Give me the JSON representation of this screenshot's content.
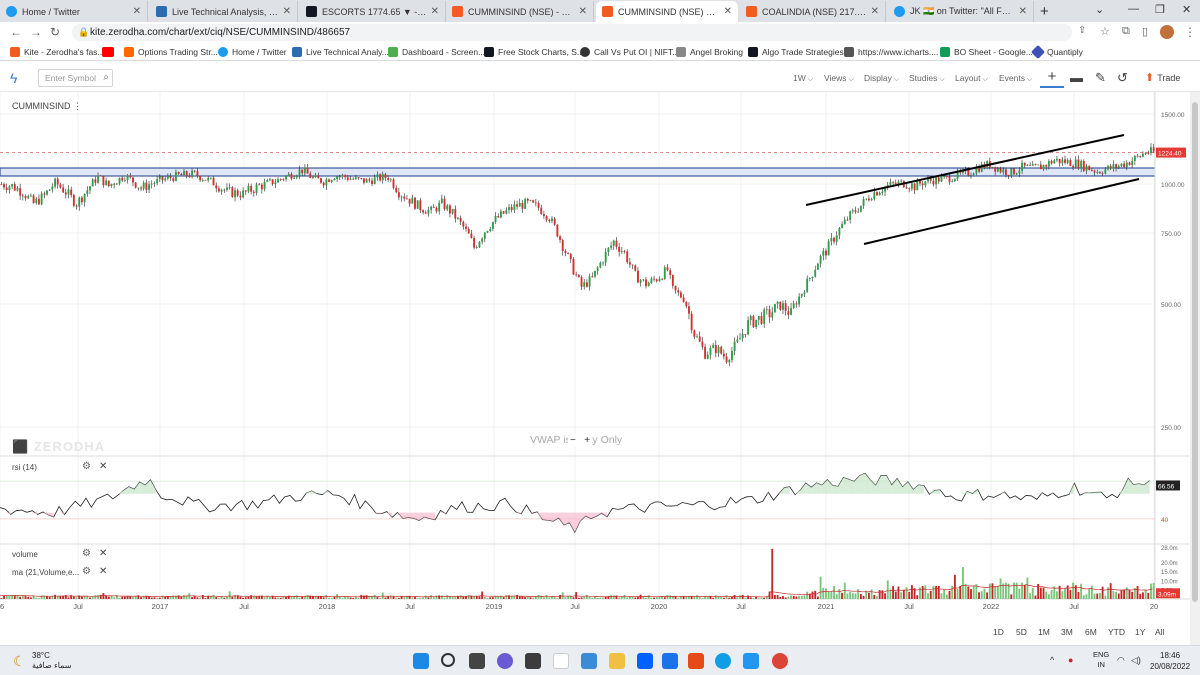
{
  "browser": {
    "tabs": [
      {
        "label": "Home / Twitter",
        "color": "#1d9bf0"
      },
      {
        "label": "Live Technical Analysis, Charts, S",
        "color": "#2b6cb0"
      },
      {
        "label": "ESCORTS 1774.65 ▼ -1.61% NIF",
        "color": "#131722"
      },
      {
        "label": "CUMMINSIND (NSE) - Kite Chart",
        "color": "#f25b21"
      },
      {
        "label": "CUMMINSIND (NSE) 1224.4 - Ki",
        "color": "#f25b21"
      },
      {
        "label": "COALINDIA (NSE) 217.15 - Kite",
        "color": "#f25b21"
      },
      {
        "label": "JK 🇮🇳 on Twitter: \"All FNO Stocks",
        "color": "#1d9bf0"
      }
    ],
    "active_tab": 4,
    "url": "kite.zerodha.com/chart/ext/ciq/NSE/CUMMINSIND/486657",
    "bookmarks": [
      {
        "label": "Kite - Zerodha's fas...",
        "color": "#f25b21"
      },
      {
        "label": "",
        "color": "#ff0000"
      },
      {
        "label": "Options Trading Str...",
        "color": "#ff6a00"
      },
      {
        "label": "Home / Twitter",
        "color": "#1d9bf0"
      },
      {
        "label": "Live Technical Analy...",
        "color": "#2b6cb0"
      },
      {
        "label": "Dashboard - Screen...",
        "color": "#4caf50"
      },
      {
        "label": "Free Stock Charts, S...",
        "color": "#131722"
      },
      {
        "label": "Call Vs Put OI | NIFT...",
        "color": "#333333"
      },
      {
        "label": "Angel Broking",
        "color": "#888888"
      },
      {
        "label": "Algo Trade Strategies",
        "color": "#131722"
      },
      {
        "label": "https://www.icharts....",
        "color": "#555555"
      },
      {
        "label": "BO Sheet - Google...",
        "color": "#0f9d58"
      },
      {
        "label": "Quantiply",
        "color": "#3f51b5"
      }
    ]
  },
  "kite": {
    "symbol_placeholder": "Enter Symbol",
    "menus": [
      "1W",
      "Views",
      "Display",
      "Studies",
      "Layout",
      "Events"
    ],
    "trade_label": "Trade",
    "symbol": "CUMMINSIND",
    "watermark": "ZERODHA",
    "vwap_note": "VWAP is  ·  ·  ay Only",
    "zoom_minus": "−",
    "zoom_plus": "+",
    "rsi_label": "rsi (14)",
    "volume_label": "volume",
    "ma_label": "ma (21,Volume,e...",
    "ranges": [
      "1D",
      "5D",
      "1M",
      "3M",
      "6M",
      "YTD",
      "1Y",
      "All"
    ]
  },
  "chart_data": {
    "type": "candlestick",
    "title": "CUMMINSIND",
    "interval": "1W",
    "last_price": "1224.40",
    "y_ticks": [
      "1500.00",
      "1000.00",
      "750.00",
      "500.00",
      "250.00"
    ],
    "x_ticks": [
      "6",
      "Jul",
      "2017",
      "Jul",
      "2018",
      "Jul",
      "2019",
      "Jul",
      "2020",
      "Jul",
      "2021",
      "Jul",
      "2022",
      "Jul",
      "20"
    ],
    "rsi": {
      "period": 14,
      "last": "66.56",
      "levels": [
        70,
        40
      ],
      "level_labels": [
        "",
        "40"
      ]
    },
    "volume": {
      "ticks": [
        "28.0m",
        "20.0m",
        "15.0m",
        "10.0m",
        "5.00m"
      ],
      "last": "3.09m"
    },
    "price_path": [
      [
        0,
        1000
      ],
      [
        4,
        990
      ],
      [
        8,
        960
      ],
      [
        12,
        900
      ],
      [
        16,
        940
      ],
      [
        20,
        1010
      ],
      [
        24,
        960
      ],
      [
        28,
        900
      ],
      [
        32,
        970
      ],
      [
        36,
        1050
      ],
      [
        40,
        990
      ],
      [
        46,
        1060
      ],
      [
        52,
        980
      ],
      [
        60,
        1030
      ],
      [
        66,
        1060
      ],
      [
        72,
        1070
      ],
      [
        78,
        1020
      ],
      [
        84,
        960
      ],
      [
        90,
        950
      ],
      [
        96,
        990
      ],
      [
        102,
        1020
      ],
      [
        108,
        1070
      ],
      [
        112,
        1100
      ],
      [
        116,
        1040
      ],
      [
        120,
        1020
      ],
      [
        124,
        1060
      ],
      [
        128,
        1050
      ],
      [
        132,
        1030
      ],
      [
        136,
        1020
      ],
      [
        140,
        1040
      ],
      [
        144,
        1050
      ],
      [
        148,
        960
      ],
      [
        152,
        920
      ],
      [
        156,
        880
      ],
      [
        160,
        860
      ],
      [
        164,
        900
      ],
      [
        168,
        850
      ],
      [
        172,
        780
      ],
      [
        176,
        700
      ],
      [
        180,
        760
      ],
      [
        184,
        820
      ],
      [
        188,
        860
      ],
      [
        192,
        890
      ],
      [
        196,
        900
      ],
      [
        200,
        880
      ],
      [
        204,
        830
      ],
      [
        208,
        730
      ],
      [
        212,
        640
      ],
      [
        216,
        560
      ],
      [
        220,
        590
      ],
      [
        224,
        660
      ],
      [
        228,
        720
      ],
      [
        232,
        680
      ],
      [
        236,
        600
      ],
      [
        240,
        570
      ],
      [
        244,
        590
      ],
      [
        248,
        620
      ],
      [
        250,
        550
      ],
      [
        254,
        520
      ],
      [
        258,
        440
      ],
      [
        262,
        400
      ],
      [
        266,
        410
      ],
      [
        270,
        390
      ],
      [
        274,
        420
      ],
      [
        278,
        460
      ],
      [
        282,
        470
      ],
      [
        286,
        480
      ],
      [
        290,
        500
      ],
      [
        294,
        480
      ],
      [
        298,
        540
      ],
      [
        302,
        610
      ],
      [
        304,
        650
      ],
      [
        308,
        700
      ],
      [
        312,
        770
      ],
      [
        316,
        840
      ],
      [
        320,
        890
      ],
      [
        324,
        950
      ],
      [
        328,
        980
      ],
      [
        332,
        1000
      ],
      [
        336,
        1010
      ],
      [
        340,
        990
      ],
      [
        344,
        1020
      ],
      [
        348,
        1030
      ],
      [
        352,
        1040
      ],
      [
        356,
        1060
      ],
      [
        360,
        1080
      ],
      [
        364,
        1120
      ],
      [
        368,
        1140
      ],
      [
        372,
        1100
      ],
      [
        376,
        1080
      ],
      [
        380,
        1120
      ],
      [
        384,
        1110
      ],
      [
        388,
        1130
      ],
      [
        392,
        1170
      ],
      [
        396,
        1160
      ],
      [
        400,
        1150
      ],
      [
        404,
        1120
      ],
      [
        408,
        1090
      ],
      [
        412,
        1110
      ],
      [
        416,
        1130
      ],
      [
        420,
        1160
      ],
      [
        424,
        1200
      ],
      [
        426,
        1230
      ],
      [
        428,
        1226
      ]
    ],
    "rsi_path": [
      [
        0,
        48
      ],
      [
        20,
        45
      ],
      [
        40,
        56
      ],
      [
        55,
        72
      ],
      [
        60,
        60
      ],
      [
        75,
        50
      ],
      [
        95,
        52
      ],
      [
        110,
        58
      ],
      [
        125,
        60
      ],
      [
        140,
        48
      ],
      [
        155,
        40
      ],
      [
        170,
        49
      ],
      [
        190,
        52
      ],
      [
        205,
        38
      ],
      [
        215,
        32
      ],
      [
        222,
        45
      ],
      [
        240,
        49
      ],
      [
        260,
        51
      ],
      [
        280,
        55
      ],
      [
        300,
        66
      ],
      [
        320,
        72
      ],
      [
        340,
        68
      ],
      [
        355,
        58
      ],
      [
        370,
        60
      ],
      [
        385,
        55
      ],
      [
        400,
        65
      ],
      [
        412,
        56
      ],
      [
        422,
        70
      ],
      [
        428,
        66.56
      ]
    ]
  }
}
